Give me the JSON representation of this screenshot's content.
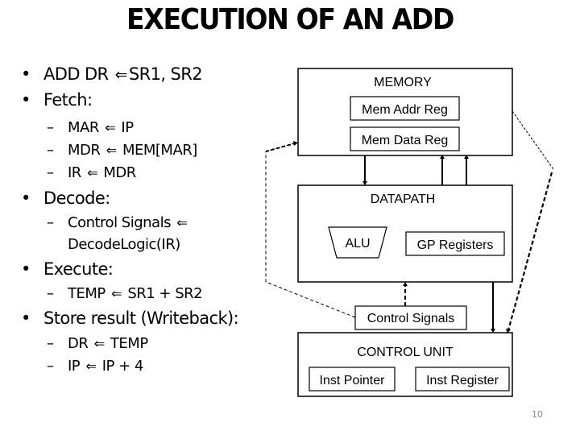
{
  "slide": {
    "title": "EXECUTION OF AN ADD",
    "page_number": "10"
  },
  "bullets": [
    {
      "level": 1,
      "marker": "•",
      "parts": [
        "ADD DR",
        "SR1, SR2"
      ],
      "has_arrow": true
    },
    {
      "level": 1,
      "marker": "•",
      "text": "Fetch:"
    },
    {
      "level": 2,
      "marker": "–",
      "parts": [
        "MAR",
        "IP"
      ],
      "has_arrow": true
    },
    {
      "level": 2,
      "marker": "–",
      "parts": [
        "MDR",
        "MEM[MAR]"
      ],
      "has_arrow": true
    },
    {
      "level": 2,
      "marker": "–",
      "parts": [
        "IR",
        "MDR"
      ],
      "has_arrow": true
    },
    {
      "level": 1,
      "marker": "•",
      "text": "Decode:"
    },
    {
      "level": 2,
      "marker": "–",
      "parts": [
        "Control Signals",
        ""
      ],
      "has_arrow": true
    },
    {
      "level": 2,
      "marker": "",
      "text": "DecodeLogic(IR)"
    },
    {
      "level": 1,
      "marker": "•",
      "text": "Execute:"
    },
    {
      "level": 2,
      "marker": "–",
      "parts": [
        "TEMP",
        "SR1 + SR2"
      ],
      "has_arrow": true
    },
    {
      "level": 1,
      "marker": "•",
      "text": "Store result (Writeback):"
    },
    {
      "level": 2,
      "marker": "–",
      "parts": [
        "DR",
        "TEMP"
      ],
      "has_arrow": true
    },
    {
      "level": 2,
      "marker": "–",
      "parts": [
        "IP",
        "IP + 4"
      ],
      "has_arrow": true
    }
  ],
  "arrow_glyph": "🡐",
  "diagram": {
    "memory": {
      "label": "MEMORY",
      "mem_addr_reg": "Mem Addr Reg",
      "mem_data_reg": "Mem Data Reg"
    },
    "datapath": {
      "label": "DATAPATH",
      "alu": "ALU",
      "gp_registers": "GP Registers"
    },
    "control_signals": "Control Signals",
    "control_unit": {
      "label": "CONTROL UNIT",
      "inst_pointer": "Inst Pointer",
      "inst_register": "Inst Register"
    }
  }
}
